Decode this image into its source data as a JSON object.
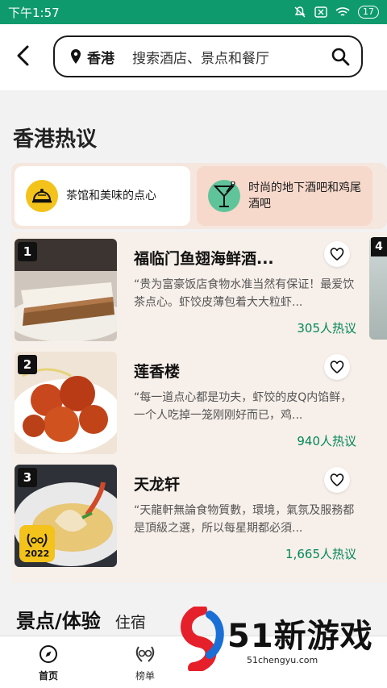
{
  "status_bar": {
    "time": "下午1:57",
    "battery": "17"
  },
  "header": {
    "location": "香港",
    "search_placeholder": "搜索酒店、景点和餐厅"
  },
  "section": {
    "title": "香港热议"
  },
  "tabs": [
    {
      "label": "茶馆和美味的点心",
      "icon": "cloche-icon",
      "color": "#f3c21b",
      "active": true
    },
    {
      "label": "时尚的地下酒吧和鸡尾酒吧",
      "icon": "cocktail-icon",
      "color": "#5fc49a",
      "active": false
    }
  ],
  "restaurants": [
    {
      "rank": "1",
      "name": "福临门鱼翅海鲜酒...",
      "quote": "“贵为富豪饭店食物水准当然有保证！最爱饮茶点心。虾饺皮薄包着大大粒虾...",
      "count": "305人热议"
    },
    {
      "rank": "2",
      "name": "莲香楼",
      "quote": "“每一道点心都是功夫，虾饺的皮Q内馅鲜，一个人吃掉一笼刚刚好而已，鸡...",
      "count": "940人热议"
    },
    {
      "rank": "3",
      "name": "天龙轩",
      "quote": "“天龍軒無論食物質數，環境，氣氛及服務都是頂級之選，所以每星期都必須...",
      "count": "1,665人热议",
      "award_year": "2022"
    }
  ],
  "peek_rank": "4",
  "bottom_section": {
    "title": "景点/体验",
    "tab2": "住宿"
  },
  "nav": {
    "home": "首页",
    "rank": "榜单"
  },
  "watermark": {
    "brand": "51新游戏",
    "url": "51chengyu.com"
  },
  "colors": {
    "status_bar": "#0f9a6d",
    "accent_green": "#00875a",
    "tab_bg": "#f5e6de"
  }
}
